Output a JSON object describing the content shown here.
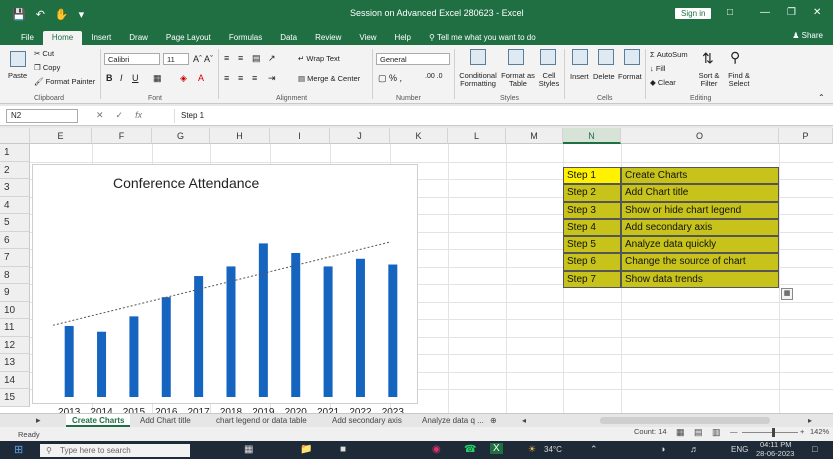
{
  "window": {
    "title": "Session on Advanced Excel 280623  -  Excel",
    "signin": "Sign in",
    "share": "Share"
  },
  "tabs": [
    "File",
    "Home",
    "Insert",
    "Draw",
    "Page Layout",
    "Formulas",
    "Data",
    "Review",
    "View",
    "Help"
  ],
  "tellme": "Tell me what you want to do",
  "ribbon": {
    "clipboard": {
      "cut": "Cut",
      "copy": "Copy",
      "paste": "Paste",
      "format_painter": "Format Painter",
      "label": "Clipboard"
    },
    "font": {
      "name": "Calibri",
      "size": "11",
      "label": "Font"
    },
    "alignment": {
      "wrap": "Wrap Text",
      "merge": "Merge & Center",
      "label": "Alignment"
    },
    "number": {
      "format": "General",
      "label": "Number"
    },
    "styles": {
      "conditional": "Conditional Formatting",
      "table": "Format as Table",
      "cell": "Cell Styles",
      "label": "Styles"
    },
    "cells": {
      "insert": "Insert",
      "delete": "Delete",
      "format": "Format",
      "label": "Cells"
    },
    "editing": {
      "autosum": "AutoSum",
      "fill": "Fill",
      "clear": "Clear",
      "sort": "Sort & Filter",
      "find": "Find & Select",
      "label": "Editing"
    }
  },
  "formula": {
    "namebox": "N2",
    "content": "Step 1"
  },
  "columns": [
    "E",
    "F",
    "G",
    "H",
    "I",
    "J",
    "K",
    "L",
    "M",
    "N",
    "O",
    "P"
  ],
  "rows": [
    "1",
    "2",
    "3",
    "4",
    "5",
    "6",
    "7",
    "8",
    "9",
    "10",
    "11",
    "12",
    "13",
    "14",
    "15"
  ],
  "steps": [
    {
      "n": "Step 1",
      "o": "Create Charts"
    },
    {
      "n": "Step 2",
      "o": "Add Chart title"
    },
    {
      "n": "Step 3",
      "o": "Show or hide chart legend"
    },
    {
      "n": "Step 4",
      "o": "Add secondary axis"
    },
    {
      "n": "Step 5",
      "o": "Analyze data quickly"
    },
    {
      "n": "Step 6",
      "o": "Change the source of chart"
    },
    {
      "n": "Step 7",
      "o": "Show data trends"
    }
  ],
  "chart_data": {
    "type": "bar",
    "title": "Conference Attendance",
    "categories": [
      "2013",
      "2014",
      "2015",
      "2016",
      "2017",
      "2018",
      "2019",
      "2020",
      "2021",
      "2022",
      "2023"
    ],
    "values": [
      37,
      34,
      42,
      52,
      63,
      68,
      80,
      75,
      68,
      72
    ],
    "values_full": [
      37,
      34,
      42,
      52,
      63,
      68,
      80,
      75,
      68,
      72,
      69
    ],
    "trendline": true,
    "bar_color": "#1565c0",
    "ylim": [
      0,
      100
    ]
  },
  "sheets": [
    "Create Charts",
    "Add Chart title",
    "chart legend or data table",
    "Add secondary axis",
    "Analyze data q ..."
  ],
  "status": {
    "ready": "Ready",
    "count": "Count: 14",
    "zoom": "142%"
  },
  "taskbar": {
    "search": "Type here to search",
    "weather": "34°C",
    "lang": "ENG",
    "time": "04:11 PM",
    "date": "28-06-2023"
  }
}
